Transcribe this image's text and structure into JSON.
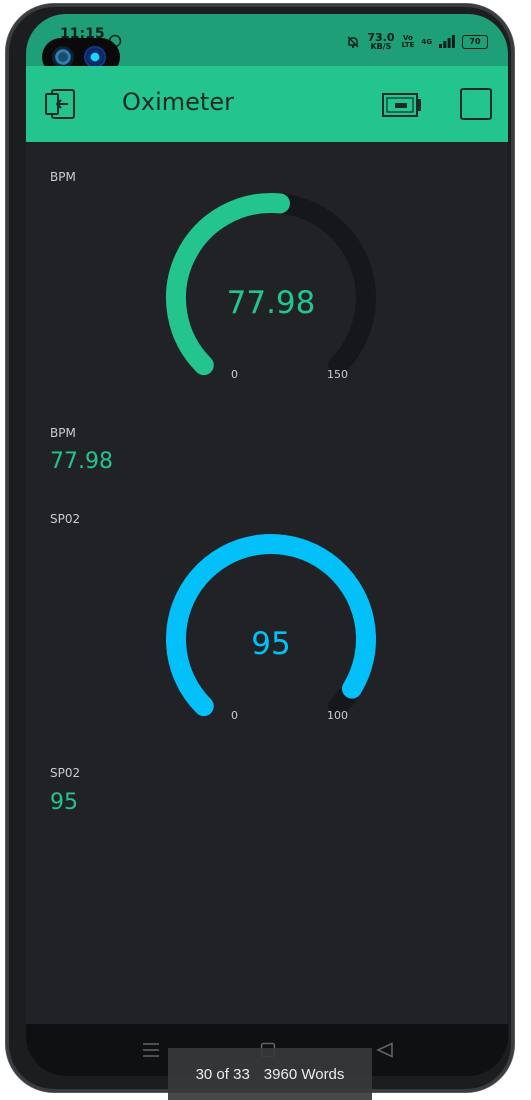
{
  "status_bar": {
    "time": "11:15",
    "net_speed_value": "73.0",
    "net_speed_unit": "KB/S",
    "volte_top": "Vo",
    "volte_bottom": "LTE",
    "network": "4G",
    "battery": "70"
  },
  "app_bar": {
    "title": "Oximeter"
  },
  "widgets": {
    "bpm_gauge": {
      "label": "BPM",
      "value": "77.98",
      "min": "0",
      "max": "150",
      "fraction": 0.52,
      "color": "#23c48e"
    },
    "bpm_display": {
      "label": "BPM",
      "value": "77.98",
      "color": "#23c48e"
    },
    "spo2_gauge": {
      "label": "SP02",
      "value": "95",
      "min": "0",
      "max": "100",
      "fraction": 0.95,
      "color": "#04c0f8"
    },
    "spo2_display": {
      "label": "SP02",
      "value": "95",
      "color": "#23c48e"
    }
  },
  "overlay": {
    "page": "30 of 33",
    "words": "3960 Words"
  },
  "icons": {
    "back": "exit-icon",
    "device": "device-icon",
    "square": "square-icon",
    "nav_menu": "menu-icon",
    "nav_home": "home-icon",
    "nav_back": "back-triangle-icon"
  }
}
